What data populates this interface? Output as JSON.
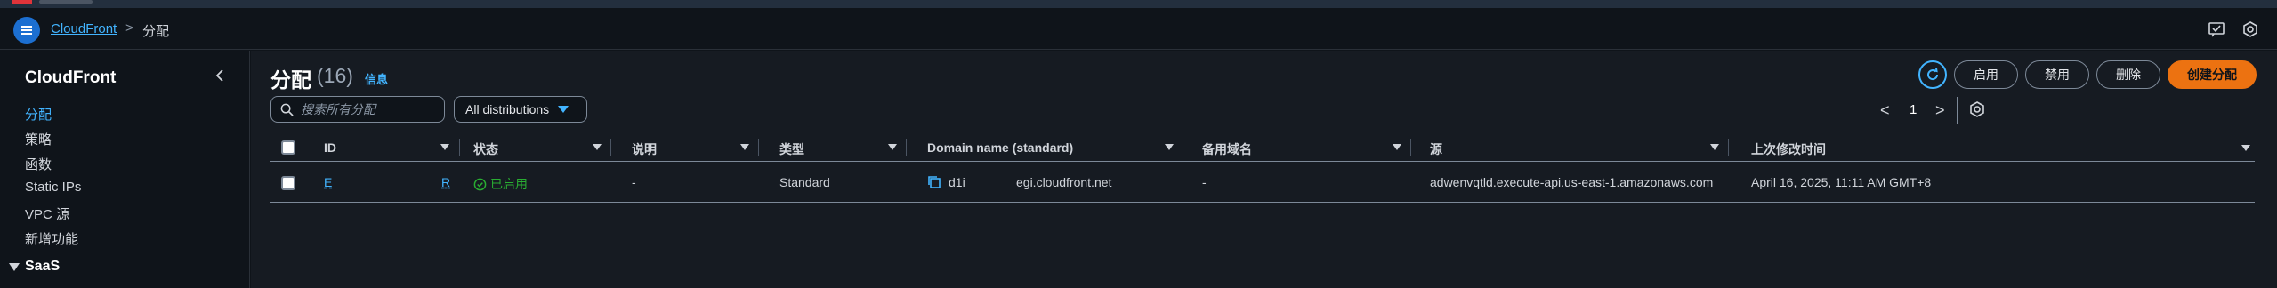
{
  "breadcrumb": {
    "service": "CloudFront",
    "separator": ">",
    "current": "分配"
  },
  "sidebar": {
    "title": "CloudFront",
    "items": [
      {
        "label": "分配",
        "active": true
      },
      {
        "label": "策略",
        "active": false
      },
      {
        "label": "函数",
        "active": false
      },
      {
        "label": "Static IPs",
        "active": false
      },
      {
        "label": "VPC 源",
        "active": false
      },
      {
        "label": "新增功能",
        "active": false
      }
    ],
    "section": "SaaS"
  },
  "page": {
    "title": "分配",
    "count": "(16)",
    "info": "信息"
  },
  "toolbar": {
    "search_placeholder": "搜索所有分配",
    "filter_value": "All distributions",
    "enable": "启用",
    "disable": "禁用",
    "delete": "删除",
    "create": "创建分配"
  },
  "pagination": {
    "prev": "<",
    "page": "1",
    "next": ">"
  },
  "table": {
    "columns": [
      "ID",
      "状态",
      "说明",
      "类型",
      "Domain name (standard)",
      "备用域名",
      "源",
      "上次修改时间"
    ],
    "rows": [
      {
        "id_start": "E",
        "id_end": "R",
        "status": "已启用",
        "description": "-",
        "type": "Standard",
        "domain_start": "d1i",
        "domain_end": "egi.cloudfront.net",
        "alt_domain": "-",
        "origin": "adwenvqtld.execute-api.us-east-1.amazonaws.com",
        "last_modified": "April 16, 2025, 11:11 AM GMT+8"
      }
    ]
  },
  "colors": {
    "accent": "#42b4ff",
    "primary_button": "#ec7211",
    "success": "#29ad32",
    "background": "#161b22"
  }
}
